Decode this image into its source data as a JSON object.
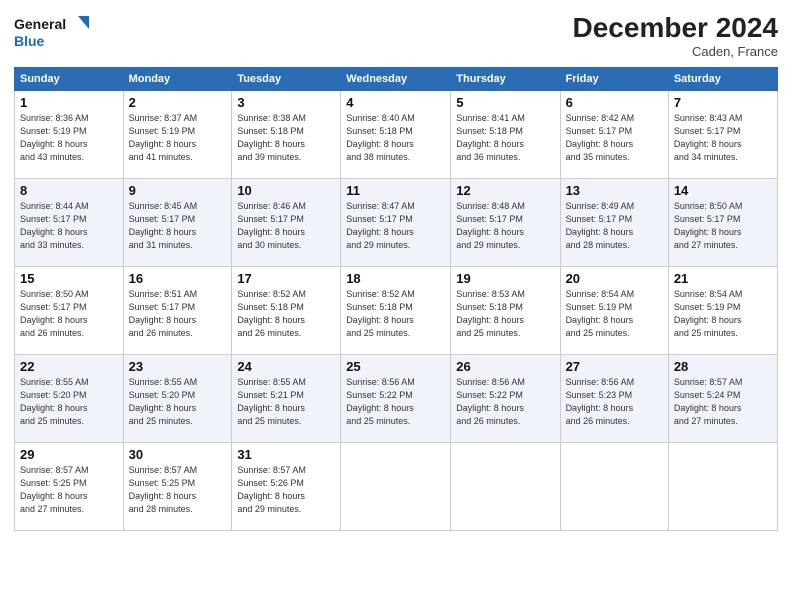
{
  "logo": {
    "line1": "General",
    "line2": "Blue"
  },
  "header": {
    "month": "December 2024",
    "location": "Caden, France"
  },
  "days_of_week": [
    "Sunday",
    "Monday",
    "Tuesday",
    "Wednesday",
    "Thursday",
    "Friday",
    "Saturday"
  ],
  "weeks": [
    [
      {
        "day": "1",
        "info": "Sunrise: 8:36 AM\nSunset: 5:19 PM\nDaylight: 8 hours\nand 43 minutes."
      },
      {
        "day": "2",
        "info": "Sunrise: 8:37 AM\nSunset: 5:19 PM\nDaylight: 8 hours\nand 41 minutes."
      },
      {
        "day": "3",
        "info": "Sunrise: 8:38 AM\nSunset: 5:18 PM\nDaylight: 8 hours\nand 39 minutes."
      },
      {
        "day": "4",
        "info": "Sunrise: 8:40 AM\nSunset: 5:18 PM\nDaylight: 8 hours\nand 38 minutes."
      },
      {
        "day": "5",
        "info": "Sunrise: 8:41 AM\nSunset: 5:18 PM\nDaylight: 8 hours\nand 36 minutes."
      },
      {
        "day": "6",
        "info": "Sunrise: 8:42 AM\nSunset: 5:17 PM\nDaylight: 8 hours\nand 35 minutes."
      },
      {
        "day": "7",
        "info": "Sunrise: 8:43 AM\nSunset: 5:17 PM\nDaylight: 8 hours\nand 34 minutes."
      }
    ],
    [
      {
        "day": "8",
        "info": "Sunrise: 8:44 AM\nSunset: 5:17 PM\nDaylight: 8 hours\nand 33 minutes."
      },
      {
        "day": "9",
        "info": "Sunrise: 8:45 AM\nSunset: 5:17 PM\nDaylight: 8 hours\nand 31 minutes."
      },
      {
        "day": "10",
        "info": "Sunrise: 8:46 AM\nSunset: 5:17 PM\nDaylight: 8 hours\nand 30 minutes."
      },
      {
        "day": "11",
        "info": "Sunrise: 8:47 AM\nSunset: 5:17 PM\nDaylight: 8 hours\nand 29 minutes."
      },
      {
        "day": "12",
        "info": "Sunrise: 8:48 AM\nSunset: 5:17 PM\nDaylight: 8 hours\nand 29 minutes."
      },
      {
        "day": "13",
        "info": "Sunrise: 8:49 AM\nSunset: 5:17 PM\nDaylight: 8 hours\nand 28 minutes."
      },
      {
        "day": "14",
        "info": "Sunrise: 8:50 AM\nSunset: 5:17 PM\nDaylight: 8 hours\nand 27 minutes."
      }
    ],
    [
      {
        "day": "15",
        "info": "Sunrise: 8:50 AM\nSunset: 5:17 PM\nDaylight: 8 hours\nand 26 minutes."
      },
      {
        "day": "16",
        "info": "Sunrise: 8:51 AM\nSunset: 5:17 PM\nDaylight: 8 hours\nand 26 minutes."
      },
      {
        "day": "17",
        "info": "Sunrise: 8:52 AM\nSunset: 5:18 PM\nDaylight: 8 hours\nand 26 minutes."
      },
      {
        "day": "18",
        "info": "Sunrise: 8:52 AM\nSunset: 5:18 PM\nDaylight: 8 hours\nand 25 minutes."
      },
      {
        "day": "19",
        "info": "Sunrise: 8:53 AM\nSunset: 5:18 PM\nDaylight: 8 hours\nand 25 minutes."
      },
      {
        "day": "20",
        "info": "Sunrise: 8:54 AM\nSunset: 5:19 PM\nDaylight: 8 hours\nand 25 minutes."
      },
      {
        "day": "21",
        "info": "Sunrise: 8:54 AM\nSunset: 5:19 PM\nDaylight: 8 hours\nand 25 minutes."
      }
    ],
    [
      {
        "day": "22",
        "info": "Sunrise: 8:55 AM\nSunset: 5:20 PM\nDaylight: 8 hours\nand 25 minutes."
      },
      {
        "day": "23",
        "info": "Sunrise: 8:55 AM\nSunset: 5:20 PM\nDaylight: 8 hours\nand 25 minutes."
      },
      {
        "day": "24",
        "info": "Sunrise: 8:55 AM\nSunset: 5:21 PM\nDaylight: 8 hours\nand 25 minutes."
      },
      {
        "day": "25",
        "info": "Sunrise: 8:56 AM\nSunset: 5:22 PM\nDaylight: 8 hours\nand 25 minutes."
      },
      {
        "day": "26",
        "info": "Sunrise: 8:56 AM\nSunset: 5:22 PM\nDaylight: 8 hours\nand 26 minutes."
      },
      {
        "day": "27",
        "info": "Sunrise: 8:56 AM\nSunset: 5:23 PM\nDaylight: 8 hours\nand 26 minutes."
      },
      {
        "day": "28",
        "info": "Sunrise: 8:57 AM\nSunset: 5:24 PM\nDaylight: 8 hours\nand 27 minutes."
      }
    ],
    [
      {
        "day": "29",
        "info": "Sunrise: 8:57 AM\nSunset: 5:25 PM\nDaylight: 8 hours\nand 27 minutes."
      },
      {
        "day": "30",
        "info": "Sunrise: 8:57 AM\nSunset: 5:25 PM\nDaylight: 8 hours\nand 28 minutes."
      },
      {
        "day": "31",
        "info": "Sunrise: 8:57 AM\nSunset: 5:26 PM\nDaylight: 8 hours\nand 29 minutes."
      },
      null,
      null,
      null,
      null
    ]
  ]
}
